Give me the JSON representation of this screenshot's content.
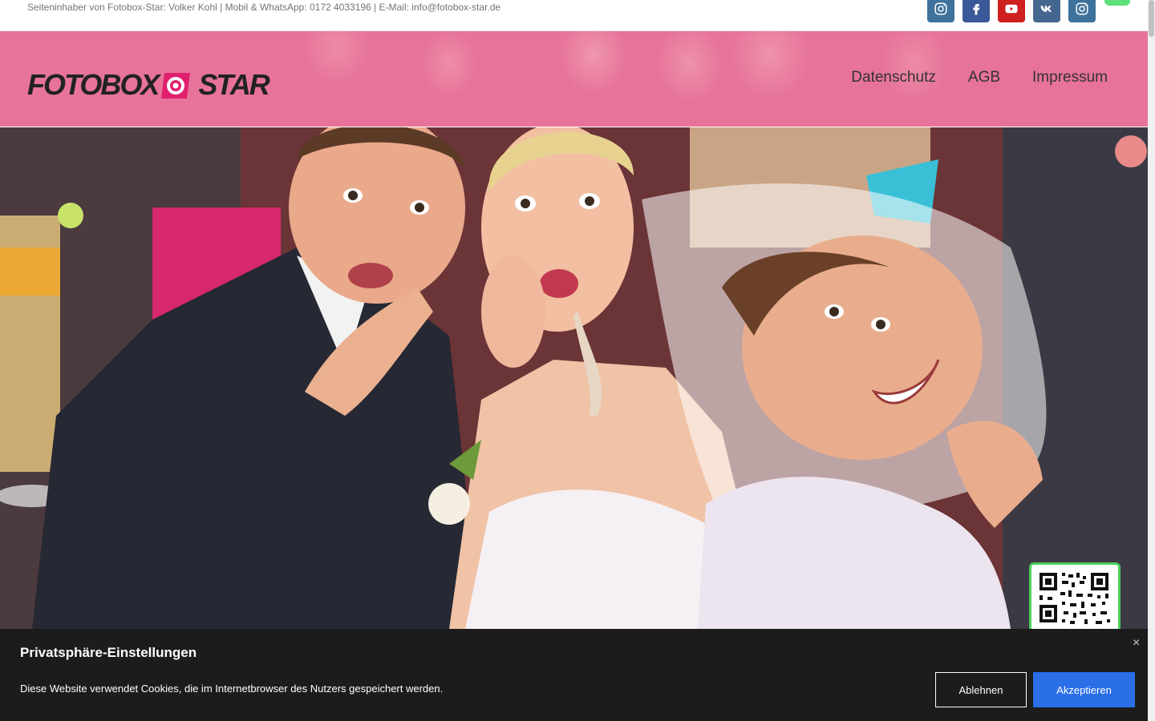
{
  "topbar": {
    "info_text": "Seiteninhaber von Fotobox-Star: Volker Kohl | Mobil & WhatsApp: 0172 4033196  |  E-Mail: info@fotobox-star.de",
    "socials": [
      {
        "icon": "instagram-icon",
        "color": "#3f729b"
      },
      {
        "icon": "facebook-icon",
        "color": "#3b5998"
      },
      {
        "icon": "youtube-icon",
        "color": "#cd201f"
      },
      {
        "icon": "vk-icon",
        "color": "#45668e"
      },
      {
        "icon": "instagram-icon",
        "color": "#3f729b"
      }
    ]
  },
  "header": {
    "logo_part1": "FOTOBOX",
    "logo_part2": "STAR",
    "accent_color": "#e0206e",
    "nav": [
      {
        "label": "Datenschutz"
      },
      {
        "label": "AGB"
      },
      {
        "label": "Impressum"
      }
    ]
  },
  "cookie": {
    "title": "Privatsphäre-Einstellungen",
    "text": "Diese Website verwendet Cookies, die im Internetbrowser des Nutzers gespeichert werden.",
    "close_symbol": "×",
    "decline_label": "Ablehnen",
    "accept_label": "Akzeptieren",
    "accept_color": "#2a6ee8"
  }
}
